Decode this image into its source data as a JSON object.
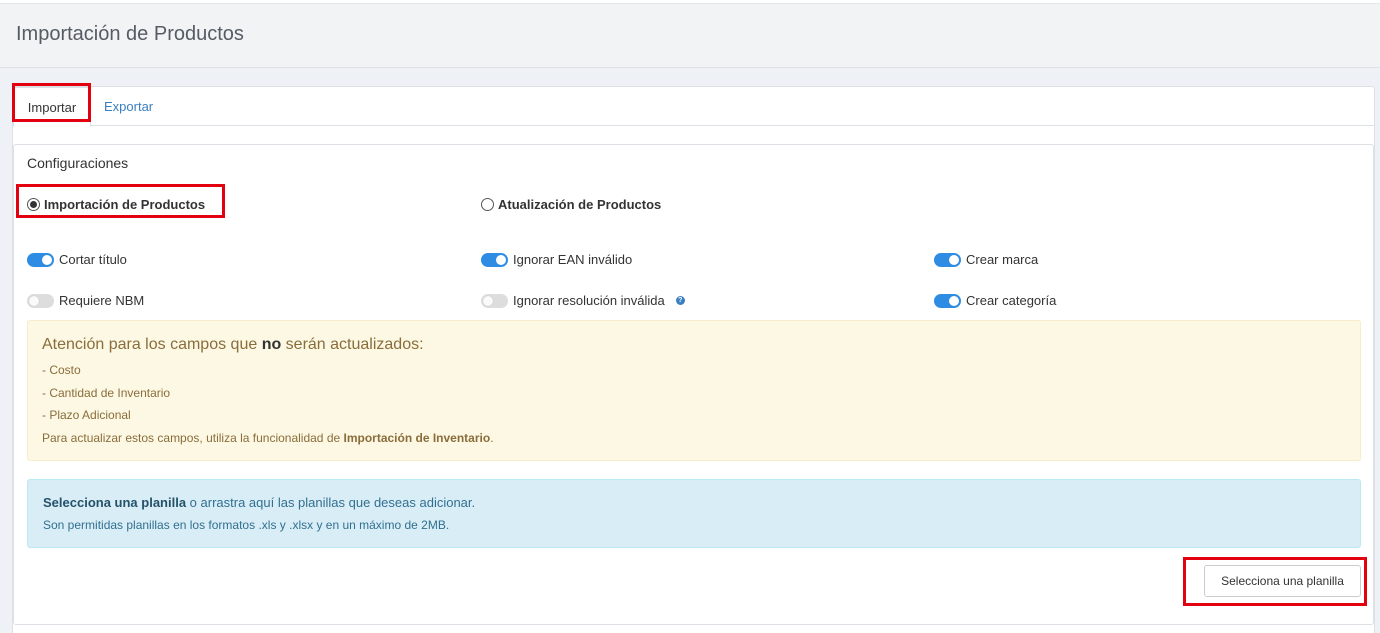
{
  "page": {
    "title": "Importación de Productos"
  },
  "tabs": [
    {
      "label": "Importar",
      "active": true
    },
    {
      "label": "Exportar",
      "active": false
    }
  ],
  "config": {
    "title": "Configuraciones",
    "modes": [
      {
        "label": "Importación de Productos",
        "checked": true
      },
      {
        "label": "Atualización de Productos",
        "checked": false
      }
    ],
    "toggles": [
      {
        "label": "Cortar título",
        "on": true
      },
      {
        "label": "Ignorar EAN inválido",
        "on": true
      },
      {
        "label": "Crear marca",
        "on": true
      },
      {
        "label": "Requiere NBM",
        "on": false
      },
      {
        "label": "Ignorar resolución inválida",
        "on": false,
        "help_icon": "question-circle-icon"
      },
      {
        "label": "Crear categoría",
        "on": true
      }
    ]
  },
  "warning": {
    "title_pre": "Atención para los campos que ",
    "title_bold": "no",
    "title_post": " serán actualizados:",
    "items": [
      "- Costo",
      "- Cantidad de Inventario",
      "- Plazo Adicional"
    ],
    "footer_pre": "Para actualizar estos campos, utiliza la funcionalidad de ",
    "footer_bold": "Importación de Inventario",
    "footer_post": "."
  },
  "upload": {
    "line1_bold": "Selecciona una planilla",
    "line1_rest": " o arrastra aquí las planillas que deseas adicionar.",
    "line2": "Son permitidas planillas en los formatos .xls y .xlsx y en un máximo de 2MB.",
    "button_label": "Selecciona una planilla"
  },
  "colors": {
    "highlight": "#e3000f",
    "toggle_on": "#2e8de3",
    "link": "#3a7fc1",
    "warning_bg": "#fcf8e3",
    "info_bg": "#d9edf7"
  }
}
